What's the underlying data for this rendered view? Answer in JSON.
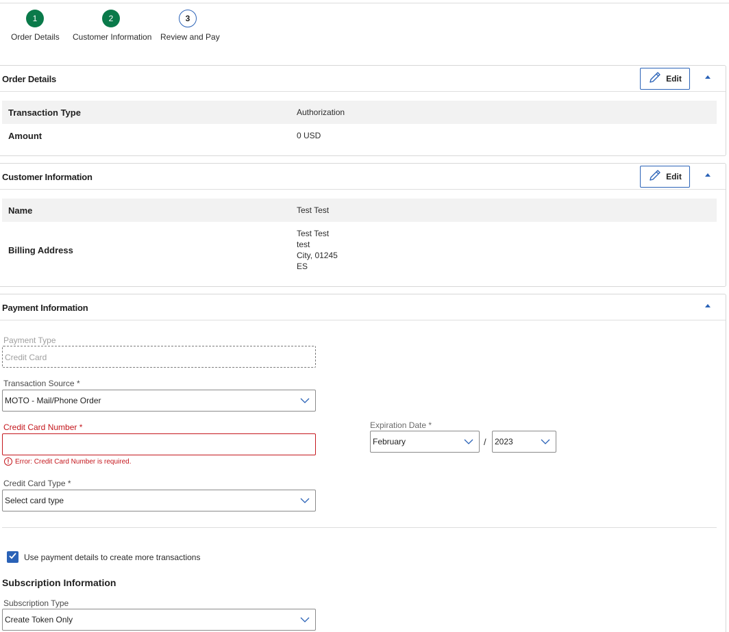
{
  "stepper": {
    "steps": [
      {
        "number": "1",
        "label": "Order Details",
        "state": "complete"
      },
      {
        "number": "2",
        "label": "Customer Information",
        "state": "complete"
      },
      {
        "number": "3",
        "label": "Review and Pay",
        "state": "current"
      }
    ]
  },
  "order_details": {
    "title": "Order Details",
    "edit_label": "Edit",
    "rows": [
      {
        "label": "Transaction Type",
        "value": "Authorization"
      },
      {
        "label": "Amount",
        "value": "0 USD"
      }
    ]
  },
  "customer_information": {
    "title": "Customer Information",
    "edit_label": "Edit",
    "name_label": "Name",
    "name_value": "Test Test",
    "address_label": "Billing Address",
    "address_lines": [
      "Test Test",
      "test",
      "City, 01245",
      "ES"
    ]
  },
  "payment_information": {
    "title": "Payment Information",
    "payment_type_label": "Payment Type",
    "payment_type_value": "Credit Card",
    "transaction_source_label": "Transaction Source *",
    "transaction_source_value": "MOTO - Mail/Phone Order",
    "card_number_label": "Credit Card Number *",
    "card_number_value": "",
    "card_number_error": "Error: Credit Card Number is required.",
    "expiration_label": "Expiration Date *",
    "expiration_month": "February",
    "expiration_separator": "/",
    "expiration_year": "2023",
    "card_type_label": "Credit Card Type *",
    "card_type_value": "Select card type",
    "reuse_checkbox_label": "Use payment details to create more transactions",
    "reuse_checked": true
  },
  "subscription_information": {
    "title": "Subscription Information",
    "type_label": "Subscription Type",
    "type_value": "Create Token Only"
  },
  "colors": {
    "accent": "#2a62b7",
    "step_complete": "#0a7a4a",
    "error": "#c4161c",
    "row_shade": "#f2f2f2"
  },
  "icons": {
    "edit": "pencil-icon",
    "collapse": "caret-up-icon",
    "dropdown": "chevron-down-icon",
    "error": "error-circle-icon",
    "checkbox": "checkmark-icon"
  }
}
